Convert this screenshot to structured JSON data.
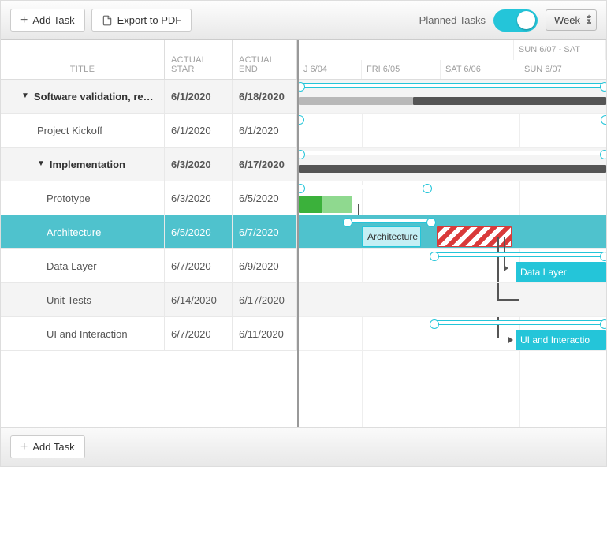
{
  "toolbar": {
    "add_task": "Add Task",
    "export_pdf": "Export to PDF",
    "switch_label": "Planned Tasks",
    "scale": "Week"
  },
  "table": {
    "headers": {
      "title": "TITLE",
      "start": "ACTUAL START",
      "end": "ACTUAL END"
    },
    "head_start_short": "ACTUAL STAR",
    "head_end_short": "ACTUAL END"
  },
  "timeline": {
    "group_label": "SUN 6/07 - SAT",
    "days": [
      "J 6/04",
      "FRI 6/05",
      "SAT 6/06",
      "SUN 6/07"
    ]
  },
  "rows": [
    {
      "title": "Software validation, re…",
      "start": "6/1/2020",
      "end": "6/18/2020",
      "type": "summary",
      "indent": 0
    },
    {
      "title": "Project Kickoff",
      "start": "6/1/2020",
      "end": "6/1/2020",
      "type": "task",
      "indent": 1
    },
    {
      "title": "Implementation",
      "start": "6/3/2020",
      "end": "6/17/2020",
      "type": "summary",
      "indent": 1
    },
    {
      "title": "Prototype",
      "start": "6/3/2020",
      "end": "6/5/2020",
      "type": "task",
      "indent": 2
    },
    {
      "title": "Architecture",
      "start": "6/5/2020",
      "end": "6/7/2020",
      "type": "task",
      "indent": 2,
      "selected": true
    },
    {
      "title": "Data Layer",
      "start": "6/7/2020",
      "end": "6/9/2020",
      "type": "task",
      "indent": 2
    },
    {
      "title": "Unit Tests",
      "start": "6/14/2020",
      "end": "6/17/2020",
      "type": "task",
      "indent": 2
    },
    {
      "title": "UI and Interaction",
      "start": "6/7/2020",
      "end": "6/11/2020",
      "type": "task",
      "indent": 2
    }
  ],
  "bar_labels": {
    "architecture": "Architecture",
    "data_layer": "Data Layer",
    "ui": "UI and Interactio"
  },
  "footer": {
    "add_task": "Add Task"
  },
  "chart_data": {
    "type": "gantt",
    "unit": "day",
    "visible_range": [
      "2020-06-04",
      "2020-06-07"
    ],
    "tasks": [
      {
        "name": "Software validation, research and implementation",
        "actual": [
          "2020-06-01",
          "2020-06-18"
        ],
        "summary": true
      },
      {
        "name": "Project Kickoff",
        "actual": [
          "2020-06-01",
          "2020-06-01"
        ]
      },
      {
        "name": "Implementation",
        "actual": [
          "2020-06-03",
          "2020-06-17"
        ],
        "summary": true
      },
      {
        "name": "Prototype",
        "actual": [
          "2020-06-03",
          "2020-06-05"
        ],
        "planned": [
          "2020-06-03",
          "2020-06-05"
        ]
      },
      {
        "name": "Architecture",
        "actual": [
          "2020-06-05",
          "2020-06-07"
        ],
        "planned": [
          "2020-06-04",
          "2020-06-06"
        ],
        "late": true
      },
      {
        "name": "Data Layer",
        "actual": [
          "2020-06-07",
          "2020-06-09"
        ],
        "planned": [
          "2020-06-06",
          "2020-06-09"
        ]
      },
      {
        "name": "Unit Tests",
        "actual": [
          "2020-06-14",
          "2020-06-17"
        ]
      },
      {
        "name": "UI and Interaction",
        "actual": [
          "2020-06-07",
          "2020-06-11"
        ],
        "planned": [
          "2020-06-06",
          "2020-06-11"
        ]
      }
    ],
    "dependencies": [
      [
        "Prototype",
        "Architecture"
      ],
      [
        "Architecture",
        "Data Layer"
      ],
      [
        "Architecture",
        "UI and Interaction"
      ],
      [
        "Architecture",
        "Unit Tests"
      ]
    ]
  }
}
